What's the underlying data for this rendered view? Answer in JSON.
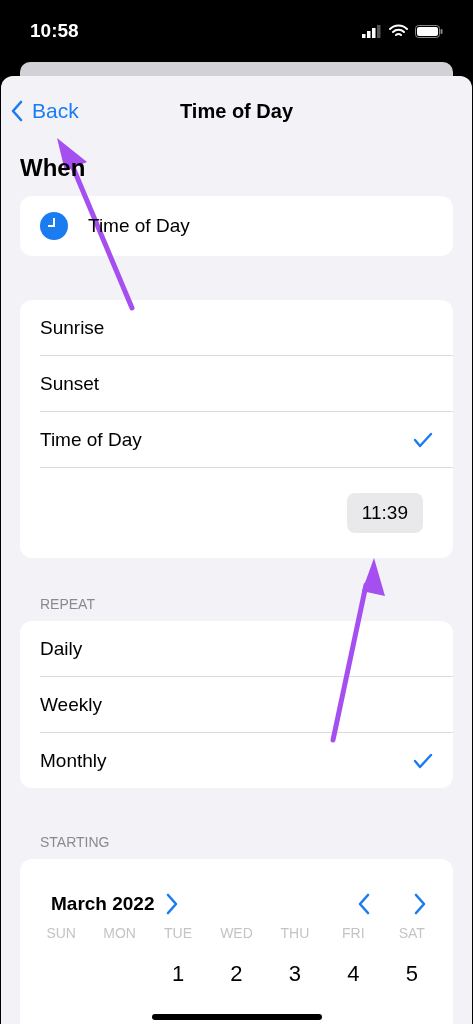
{
  "status_bar": {
    "time": "10:58"
  },
  "nav": {
    "back": "Back",
    "title": "Time of Day"
  },
  "when": {
    "heading": "When",
    "item": "Time of Day"
  },
  "options": [
    {
      "label": "Sunrise",
      "selected": false
    },
    {
      "label": "Sunset",
      "selected": false
    },
    {
      "label": "Time of Day",
      "selected": true
    }
  ],
  "time_value": "11:39",
  "repeat": {
    "heading": "REPEAT",
    "options": [
      {
        "label": "Daily",
        "selected": false
      },
      {
        "label": "Weekly",
        "selected": false
      },
      {
        "label": "Monthly",
        "selected": true
      }
    ]
  },
  "starting": {
    "heading": "STARTING",
    "month": "March 2022",
    "weekdays": [
      "SUN",
      "MON",
      "TUE",
      "WED",
      "THU",
      "FRI",
      "SAT"
    ],
    "days": [
      "1",
      "2",
      "3",
      "4",
      "5"
    ]
  }
}
